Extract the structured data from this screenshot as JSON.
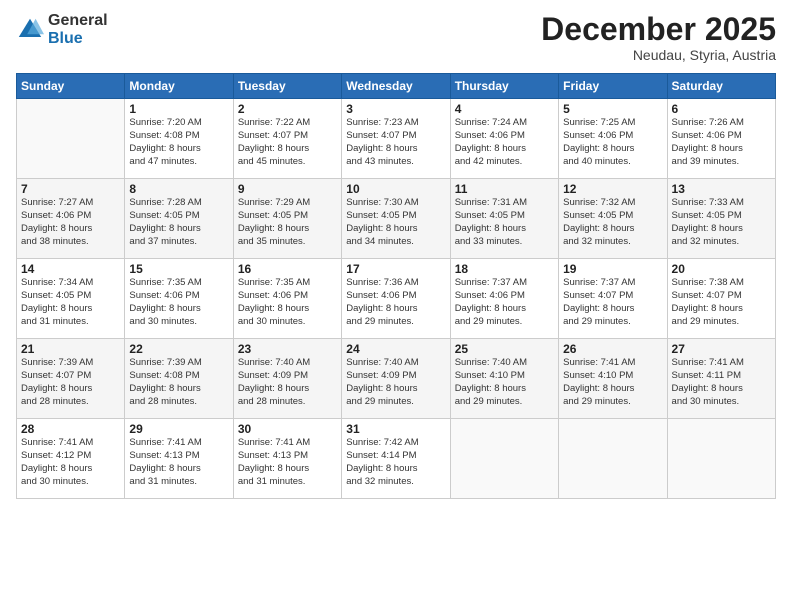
{
  "header": {
    "logo_general": "General",
    "logo_blue": "Blue",
    "month_title": "December 2025",
    "location": "Neudau, Styria, Austria"
  },
  "days_of_week": [
    "Sunday",
    "Monday",
    "Tuesday",
    "Wednesday",
    "Thursday",
    "Friday",
    "Saturday"
  ],
  "weeks": [
    [
      {
        "day": "",
        "info": ""
      },
      {
        "day": "1",
        "info": "Sunrise: 7:20 AM\nSunset: 4:08 PM\nDaylight: 8 hours\nand 47 minutes."
      },
      {
        "day": "2",
        "info": "Sunrise: 7:22 AM\nSunset: 4:07 PM\nDaylight: 8 hours\nand 45 minutes."
      },
      {
        "day": "3",
        "info": "Sunrise: 7:23 AM\nSunset: 4:07 PM\nDaylight: 8 hours\nand 43 minutes."
      },
      {
        "day": "4",
        "info": "Sunrise: 7:24 AM\nSunset: 4:06 PM\nDaylight: 8 hours\nand 42 minutes."
      },
      {
        "day": "5",
        "info": "Sunrise: 7:25 AM\nSunset: 4:06 PM\nDaylight: 8 hours\nand 40 minutes."
      },
      {
        "day": "6",
        "info": "Sunrise: 7:26 AM\nSunset: 4:06 PM\nDaylight: 8 hours\nand 39 minutes."
      }
    ],
    [
      {
        "day": "7",
        "info": "Sunrise: 7:27 AM\nSunset: 4:06 PM\nDaylight: 8 hours\nand 38 minutes."
      },
      {
        "day": "8",
        "info": "Sunrise: 7:28 AM\nSunset: 4:05 PM\nDaylight: 8 hours\nand 37 minutes."
      },
      {
        "day": "9",
        "info": "Sunrise: 7:29 AM\nSunset: 4:05 PM\nDaylight: 8 hours\nand 35 minutes."
      },
      {
        "day": "10",
        "info": "Sunrise: 7:30 AM\nSunset: 4:05 PM\nDaylight: 8 hours\nand 34 minutes."
      },
      {
        "day": "11",
        "info": "Sunrise: 7:31 AM\nSunset: 4:05 PM\nDaylight: 8 hours\nand 33 minutes."
      },
      {
        "day": "12",
        "info": "Sunrise: 7:32 AM\nSunset: 4:05 PM\nDaylight: 8 hours\nand 32 minutes."
      },
      {
        "day": "13",
        "info": "Sunrise: 7:33 AM\nSunset: 4:05 PM\nDaylight: 8 hours\nand 32 minutes."
      }
    ],
    [
      {
        "day": "14",
        "info": "Sunrise: 7:34 AM\nSunset: 4:05 PM\nDaylight: 8 hours\nand 31 minutes."
      },
      {
        "day": "15",
        "info": "Sunrise: 7:35 AM\nSunset: 4:06 PM\nDaylight: 8 hours\nand 30 minutes."
      },
      {
        "day": "16",
        "info": "Sunrise: 7:35 AM\nSunset: 4:06 PM\nDaylight: 8 hours\nand 30 minutes."
      },
      {
        "day": "17",
        "info": "Sunrise: 7:36 AM\nSunset: 4:06 PM\nDaylight: 8 hours\nand 29 minutes."
      },
      {
        "day": "18",
        "info": "Sunrise: 7:37 AM\nSunset: 4:06 PM\nDaylight: 8 hours\nand 29 minutes."
      },
      {
        "day": "19",
        "info": "Sunrise: 7:37 AM\nSunset: 4:07 PM\nDaylight: 8 hours\nand 29 minutes."
      },
      {
        "day": "20",
        "info": "Sunrise: 7:38 AM\nSunset: 4:07 PM\nDaylight: 8 hours\nand 29 minutes."
      }
    ],
    [
      {
        "day": "21",
        "info": "Sunrise: 7:39 AM\nSunset: 4:07 PM\nDaylight: 8 hours\nand 28 minutes."
      },
      {
        "day": "22",
        "info": "Sunrise: 7:39 AM\nSunset: 4:08 PM\nDaylight: 8 hours\nand 28 minutes."
      },
      {
        "day": "23",
        "info": "Sunrise: 7:40 AM\nSunset: 4:09 PM\nDaylight: 8 hours\nand 28 minutes."
      },
      {
        "day": "24",
        "info": "Sunrise: 7:40 AM\nSunset: 4:09 PM\nDaylight: 8 hours\nand 29 minutes."
      },
      {
        "day": "25",
        "info": "Sunrise: 7:40 AM\nSunset: 4:10 PM\nDaylight: 8 hours\nand 29 minutes."
      },
      {
        "day": "26",
        "info": "Sunrise: 7:41 AM\nSunset: 4:10 PM\nDaylight: 8 hours\nand 29 minutes."
      },
      {
        "day": "27",
        "info": "Sunrise: 7:41 AM\nSunset: 4:11 PM\nDaylight: 8 hours\nand 30 minutes."
      }
    ],
    [
      {
        "day": "28",
        "info": "Sunrise: 7:41 AM\nSunset: 4:12 PM\nDaylight: 8 hours\nand 30 minutes."
      },
      {
        "day": "29",
        "info": "Sunrise: 7:41 AM\nSunset: 4:13 PM\nDaylight: 8 hours\nand 31 minutes."
      },
      {
        "day": "30",
        "info": "Sunrise: 7:41 AM\nSunset: 4:13 PM\nDaylight: 8 hours\nand 31 minutes."
      },
      {
        "day": "31",
        "info": "Sunrise: 7:42 AM\nSunset: 4:14 PM\nDaylight: 8 hours\nand 32 minutes."
      },
      {
        "day": "",
        "info": ""
      },
      {
        "day": "",
        "info": ""
      },
      {
        "day": "",
        "info": ""
      }
    ]
  ]
}
